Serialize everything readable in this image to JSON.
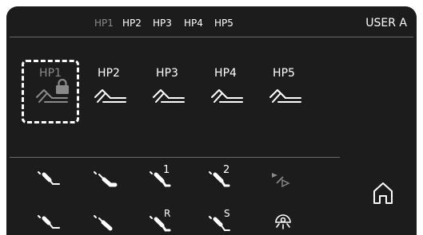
{
  "tabs": [
    "HP1",
    "HP2",
    "HP3",
    "HP4",
    "HP5"
  ],
  "active_tab": "HP1",
  "user_label": "USER A",
  "handpieces": [
    {
      "label": "HP1",
      "selected": true,
      "locked": true
    },
    {
      "label": "HP2",
      "selected": false,
      "locked": false
    },
    {
      "label": "HP3",
      "selected": false,
      "locked": false
    },
    {
      "label": "HP4",
      "selected": false,
      "locked": false
    },
    {
      "label": "HP5",
      "selected": false,
      "locked": false
    }
  ],
  "tool_marks": {
    "row1_col3": "1",
    "row1_col4": "2",
    "row2_col3": "R",
    "row2_col4": "S"
  },
  "colors": {
    "background": "#1c1c1c",
    "text": "#ffffff",
    "inactive": "#8a8a8a",
    "divider": "#6a6a6a"
  }
}
